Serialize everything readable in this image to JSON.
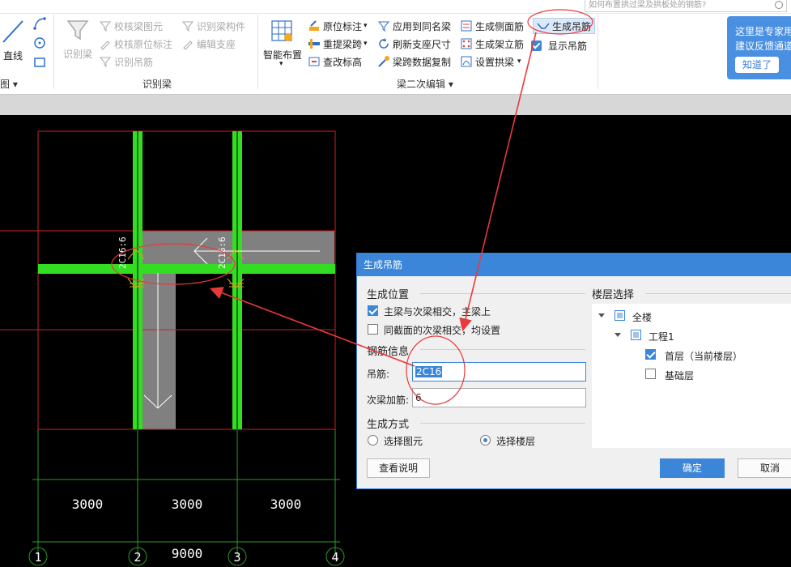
{
  "ribbon": {
    "search_placeholder": "如何布置拱过梁及拱板处的钢筋?",
    "draw": {
      "line": "直线",
      "group": "图"
    },
    "recognize": {
      "main_btn": "识别梁",
      "check_beam": "校核梁图元",
      "check_origin": "校核原位标注",
      "recognize_hanger": "识别吊筋",
      "recognize_member": "识别梁构件",
      "edit_support": "编辑支座",
      "group": "识别梁"
    },
    "secondary_edit": {
      "smart_place": "智能布置",
      "origin_label": "原位标注",
      "re_extract_span": "重提梁跨",
      "check_elev": "查改标高",
      "apply_same": "应用到同名梁",
      "refresh_support": "刷新支座尺寸",
      "span_copy": "梁跨数据复制",
      "gen_side": "生成侧面筋",
      "gen_frame": "生成架立筋",
      "set_arch": "设置拱梁",
      "gen_hanger": "生成吊筋",
      "show_hanger": "显示吊筋",
      "group": "梁二次编辑"
    }
  },
  "tip": {
    "line1": "这里是专家用",
    "line2": "建议反馈通道",
    "button": "知道了"
  },
  "canvas": {
    "dims": [
      "3000",
      "3000",
      "3000"
    ],
    "total": "9000",
    "axes": [
      "1",
      "2",
      "3",
      "4"
    ],
    "beam_labels": [
      "2C16:6",
      "2C16:6"
    ]
  },
  "dialog": {
    "title": "生成吊筋",
    "position_section": "生成位置",
    "opt_main_secondary": "主梁与次梁相交，主梁上",
    "opt_same_section": "同截面的次梁相交，均设置",
    "rebar_section": "钢筋信息",
    "hanger_label": "吊筋:",
    "hanger_value": "2C16",
    "secondary_label": "次梁加筋:",
    "secondary_value": "6",
    "method_section": "生成方式",
    "method_element": "选择图元",
    "method_floor": "选择楼层",
    "floor_section": "楼层选择",
    "tree": {
      "all": "全楼",
      "project": "工程1",
      "first": "首层（当前楼层）",
      "base": "基础层"
    },
    "help": "查看说明",
    "ok": "确定",
    "cancel": "取消"
  },
  "colors": {
    "beam": "#33dd22",
    "grid": "#d02020",
    "axis": "#2a9a2a",
    "dialog_title": "#3b86d8",
    "annotation": "#e8393b"
  }
}
